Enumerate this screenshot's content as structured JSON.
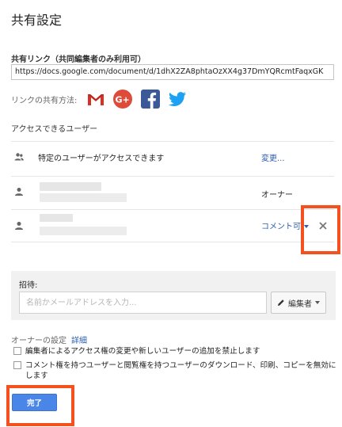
{
  "dialog": {
    "title": "共有設定"
  },
  "share_link": {
    "label": "共有リンク（共同編集者のみ利用可）",
    "url": "https://docs.google.com/document/d/1dhX2ZA8phtaOzXX4g37DmYQRcmtFaqxGK"
  },
  "share_via": {
    "label": "リンクの共有方法:",
    "services": [
      "gmail-icon",
      "google-plus-icon",
      "facebook-icon",
      "twitter-icon"
    ]
  },
  "access": {
    "label": "アクセスできるユーザー",
    "visibility": {
      "text": "特定のユーザーがアクセスできます",
      "change_link": "変更..."
    },
    "owner": {
      "role": "オーナー"
    },
    "collaborator": {
      "role": "コメント可"
    }
  },
  "invite": {
    "label": "招待:",
    "placeholder": "名前かメールアドレスを入力...",
    "permission": "編集者"
  },
  "owner_settings": {
    "label": "オーナーの設定",
    "detail_link": "詳細",
    "options": [
      {
        "text": "編集者によるアクセス権の変更や新しいユーザーの追加を禁止します",
        "checked": false
      },
      {
        "text": "コメント権を持つユーザーと閲覧権を持つユーザーのダウンロード、印刷、コピーを無効にします",
        "checked": false
      }
    ]
  },
  "done_button": "完了",
  "colors": {
    "link": "#2a5db0",
    "primary": "#4a86e8",
    "highlight": "#f4511e"
  }
}
